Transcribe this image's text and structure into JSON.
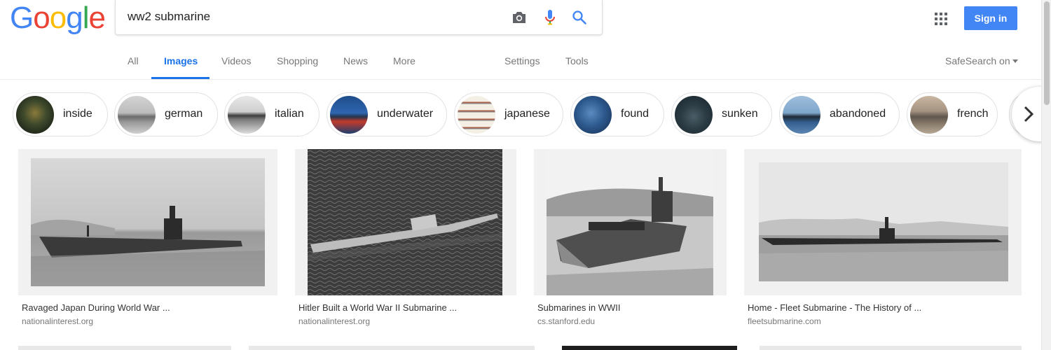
{
  "logo": {
    "letters": [
      "G",
      "o",
      "o",
      "g",
      "l",
      "e"
    ],
    "colors": [
      "#4285f4",
      "#ea4335",
      "#fbbc05",
      "#4285f4",
      "#34a853",
      "#ea4335"
    ]
  },
  "search": {
    "value": "ww2 submarine"
  },
  "header": {
    "signin_label": "Sign in"
  },
  "tabs": [
    {
      "label": "All"
    },
    {
      "label": "Images"
    },
    {
      "label": "Videos"
    },
    {
      "label": "Shopping"
    },
    {
      "label": "News"
    },
    {
      "label": "More"
    },
    {
      "label": "Settings"
    },
    {
      "label": "Tools"
    }
  ],
  "active_tab": "Images",
  "safesearch": {
    "label": "SafeSearch on"
  },
  "chips": [
    {
      "label": "inside"
    },
    {
      "label": "german"
    },
    {
      "label": "italian"
    },
    {
      "label": "underwater"
    },
    {
      "label": "japanese"
    },
    {
      "label": "found"
    },
    {
      "label": "sunken"
    },
    {
      "label": "abandoned"
    },
    {
      "label": "french"
    }
  ],
  "results": [
    {
      "title": "Ravaged Japan During World War ...",
      "site": "nationalinterest.org"
    },
    {
      "title": "Hitler Built a World War II Submarine ...",
      "site": "nationalinterest.org"
    },
    {
      "title": "Submarines in WWII",
      "site": "cs.stanford.edu"
    },
    {
      "title": "Home - Fleet Submarine - The History of ...",
      "site": "fleetsubmarine.com"
    }
  ],
  "colors": {
    "accent": "#1a73e8",
    "signin_bg": "#4285f4",
    "chip_border": "#dfe1e5"
  },
  "icons": [
    "camera-icon",
    "microphone-icon",
    "search-icon",
    "apps-grid-icon",
    "chevron-right-icon"
  ]
}
